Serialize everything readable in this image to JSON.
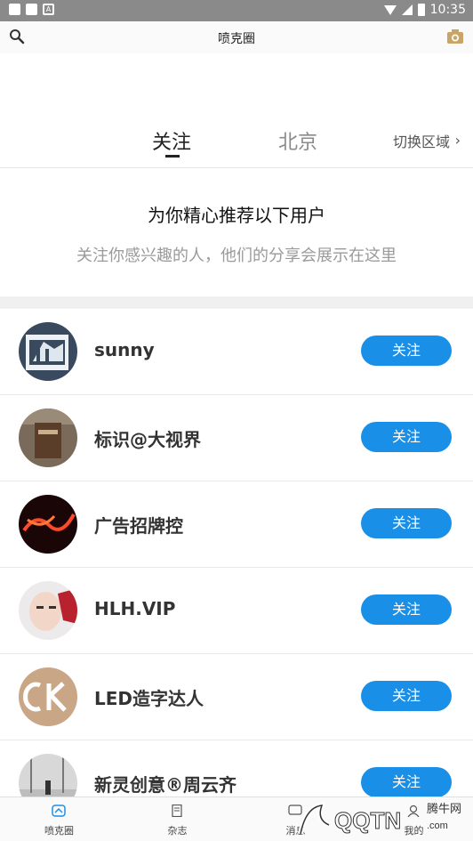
{
  "statusbar": {
    "time": "10:35"
  },
  "appbar": {
    "title": "喷克圈"
  },
  "tabs": {
    "follow": "关注",
    "beijing": "北京",
    "switch": "切换区域",
    "switch_chevron": "›"
  },
  "recommend": {
    "heading": "为你精心推荐以下用户",
    "subtitle": "关注你感兴趣的人，他们的分享会展示在这里"
  },
  "users": [
    {
      "name": "sunny",
      "button": "关注"
    },
    {
      "name": "标识@大视界",
      "button": "关注"
    },
    {
      "name": "广告招牌控",
      "button": "关注"
    },
    {
      "name": "HLH.VIP",
      "button": "关注"
    },
    {
      "name": "LED造字达人",
      "button": "关注"
    },
    {
      "name": "新灵创意®周云齐",
      "button": "关注"
    }
  ],
  "bottom_nav": [
    {
      "label": "喷克圈"
    },
    {
      "label": "杂志"
    },
    {
      "label": "消息"
    },
    {
      "label": "我的"
    }
  ],
  "watermark": {
    "site": "腾牛网",
    "brand": "QQTN.com"
  },
  "colors": {
    "accent": "#1a8fe8",
    "statusbar": "#8a8a8a",
    "camera": "#c8a466"
  }
}
